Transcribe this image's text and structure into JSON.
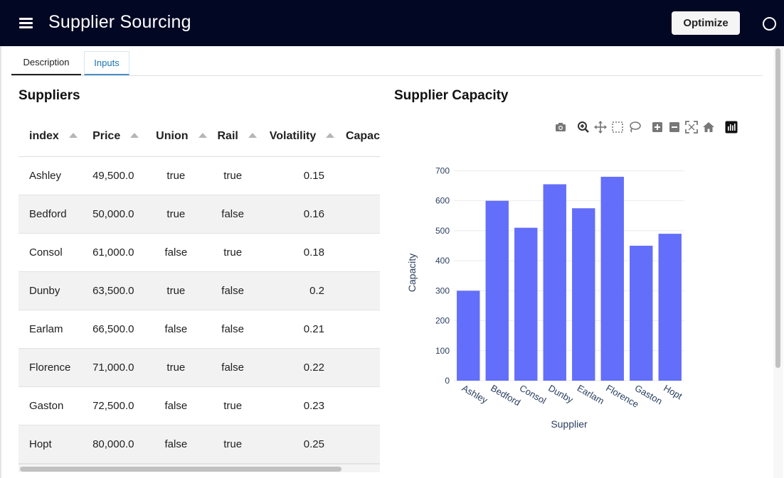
{
  "app": {
    "title": "Supplier Sourcing",
    "optimize_label": "Optimize"
  },
  "tabs": [
    {
      "label": "Description"
    },
    {
      "label": "Inputs",
      "active": true
    }
  ],
  "table": {
    "title": "Suppliers",
    "columns": [
      "index",
      "Price",
      "Union",
      "Rail",
      "Volatility",
      "Capac"
    ],
    "rows": [
      [
        "Ashley",
        "49,500.0",
        "true",
        "true",
        "0.15"
      ],
      [
        "Bedford",
        "50,000.0",
        "true",
        "false",
        "0.16"
      ],
      [
        "Consol",
        "61,000.0",
        "false",
        "true",
        "0.18"
      ],
      [
        "Dunby",
        "63,500.0",
        "true",
        "false",
        "0.2"
      ],
      [
        "Earlam",
        "66,500.0",
        "false",
        "false",
        "0.21"
      ],
      [
        "Florence",
        "71,000.0",
        "true",
        "false",
        "0.22"
      ],
      [
        "Gaston",
        "72,500.0",
        "false",
        "true",
        "0.23"
      ],
      [
        "Hopt",
        "80,000.0",
        "false",
        "true",
        "0.25"
      ]
    ]
  },
  "chart_section": {
    "title": "Supplier Capacity"
  },
  "modebar": [
    "camera-icon",
    "zoom-icon",
    "pan-icon",
    "box-select-icon",
    "lasso-select-icon",
    "zoom-in-icon",
    "zoom-out-icon",
    "autoscale-icon",
    "reset-axes-icon",
    "plotly-logo-icon"
  ],
  "chart_data": {
    "type": "bar",
    "categories": [
      "Ashley",
      "Bedford",
      "Consol",
      "Dunby",
      "Earlam",
      "Florence",
      "Gaston",
      "Hopt"
    ],
    "values": [
      300,
      600,
      510,
      655,
      575,
      680,
      450,
      490
    ],
    "xlabel": "Supplier",
    "ylabel": "Capacity",
    "ylim": [
      0,
      720
    ],
    "yticks": [
      0,
      100,
      200,
      300,
      400,
      500,
      600,
      700
    ],
    "grid": true,
    "color": "#636efa"
  },
  "colors": {
    "appbar": "#020723",
    "accent": "#1a73b5",
    "bar": "#636efa"
  }
}
